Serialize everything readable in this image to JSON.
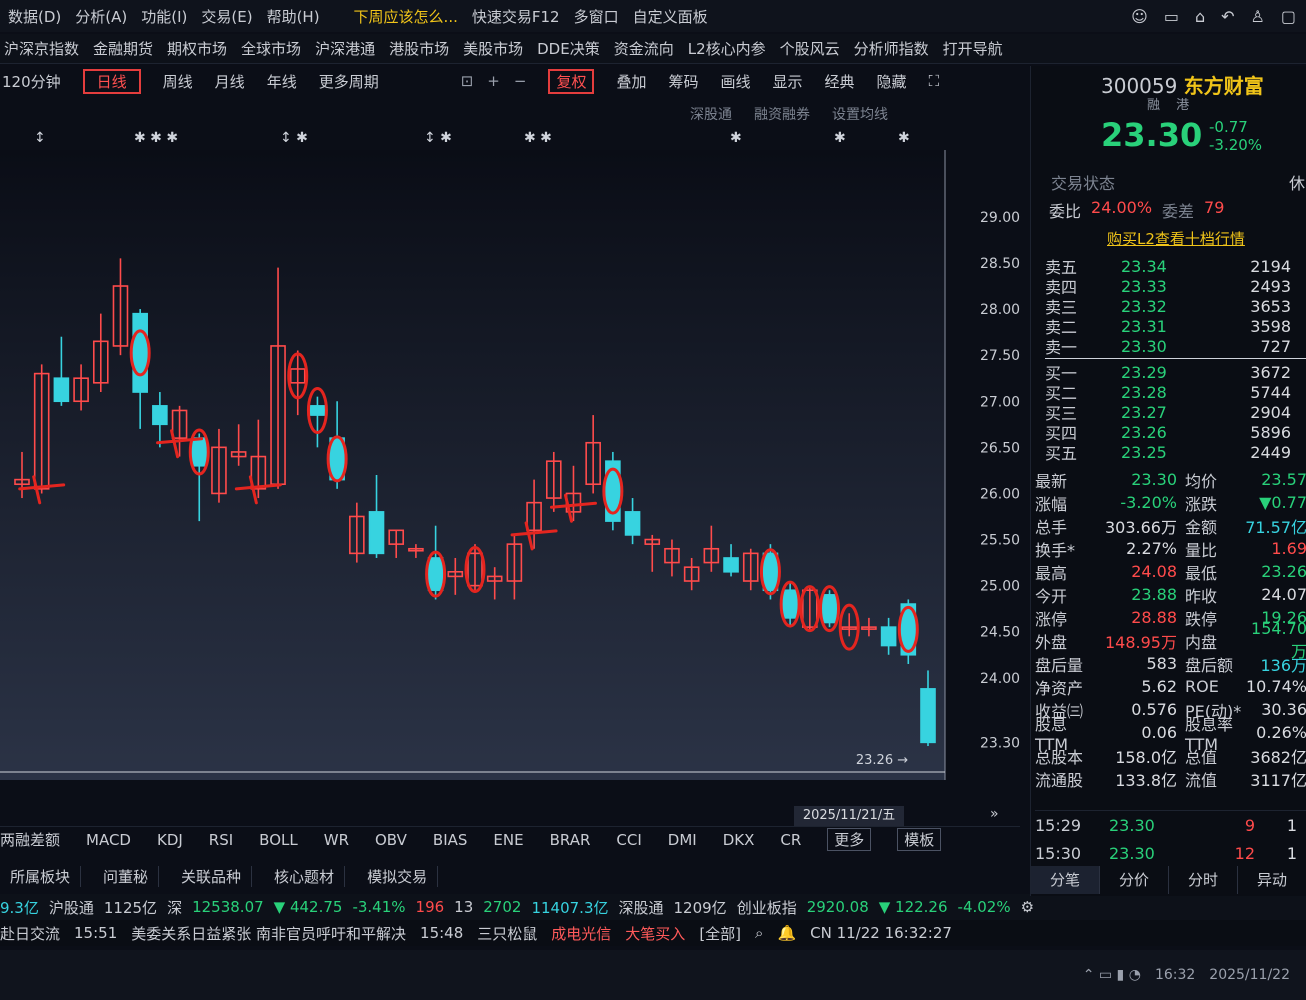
{
  "menubar": {
    "items": [
      "数据(D)",
      "分析(A)",
      "功能(I)",
      "交易(E)",
      "帮助(H)"
    ],
    "ad": "下周应该怎么...",
    "quick_trade": "快速交易F12",
    "multi_window": "多窗口",
    "custom_panel": "自定义面板"
  },
  "navbar": {
    "items": [
      "沪深京指数",
      "金融期货",
      "期权市场",
      "全球市场",
      "沪深港通",
      "港股市场",
      "美股市场",
      "DDE决策",
      "资金流向",
      "L2核心内参",
      "个股风云",
      "分析师指数",
      "打开导航"
    ]
  },
  "toolbar": {
    "period_prefix": "120分钟",
    "active_period": "日线",
    "periods": [
      "周线",
      "月线",
      "年线",
      "更多周期"
    ],
    "fuquan": "复权",
    "items": [
      "叠加",
      "筹码",
      "画线",
      "显示",
      "经典",
      "隐藏"
    ]
  },
  "subtool": [
    "深股通",
    "融资融券",
    "设置均线"
  ],
  "chart_data": {
    "type": "candlestick",
    "y_ticks": [
      "29.00",
      "28.50",
      "28.00",
      "27.50",
      "27.00",
      "26.50",
      "26.00",
      "25.50",
      "25.00",
      "24.50",
      "24.00",
      "23.30"
    ],
    "ylim": [
      23.0,
      29.4
    ],
    "last_label": "23.26",
    "date": "2025/11/21/五",
    "candles": [
      {
        "o": 26.1,
        "h": 26.45,
        "l": 25.95,
        "c": 26.15
      },
      {
        "o": 26.05,
        "h": 27.4,
        "l": 26.0,
        "c": 27.3
      },
      {
        "o": 27.25,
        "h": 27.7,
        "l": 26.95,
        "c": 27.0
      },
      {
        "o": 27.0,
        "h": 27.4,
        "l": 26.9,
        "c": 27.25
      },
      {
        "o": 27.2,
        "h": 27.95,
        "l": 27.1,
        "c": 27.65
      },
      {
        "o": 27.6,
        "h": 28.55,
        "l": 27.5,
        "c": 28.25
      },
      {
        "o": 27.95,
        "h": 28.0,
        "l": 26.7,
        "c": 27.1
      },
      {
        "o": 26.95,
        "h": 27.1,
        "l": 26.5,
        "c": 26.75
      },
      {
        "o": 26.6,
        "h": 26.95,
        "l": 26.4,
        "c": 26.9
      },
      {
        "o": 26.6,
        "h": 26.65,
        "l": 25.7,
        "c": 26.3
      },
      {
        "o": 26.0,
        "h": 26.7,
        "l": 25.9,
        "c": 26.5
      },
      {
        "o": 26.4,
        "h": 26.75,
        "l": 26.3,
        "c": 26.45
      },
      {
        "o": 26.05,
        "h": 26.8,
        "l": 25.95,
        "c": 26.4
      },
      {
        "o": 26.1,
        "h": 28.45,
        "l": 26.05,
        "c": 27.6
      },
      {
        "o": 27.2,
        "h": 27.55,
        "l": 26.85,
        "c": 27.35
      },
      {
        "o": 26.95,
        "h": 27.05,
        "l": 26.5,
        "c": 26.85
      },
      {
        "o": 26.6,
        "h": 27.0,
        "l": 26.05,
        "c": 26.15
      },
      {
        "o": 25.35,
        "h": 25.9,
        "l": 25.25,
        "c": 25.75
      },
      {
        "o": 25.8,
        "h": 26.2,
        "l": 25.3,
        "c": 25.35
      },
      {
        "o": 25.45,
        "h": 25.6,
        "l": 25.3,
        "c": 25.6
      },
      {
        "o": 25.4,
        "h": 25.45,
        "l": 25.3,
        "c": 25.4
      },
      {
        "o": 25.3,
        "h": 25.65,
        "l": 24.85,
        "c": 24.95
      },
      {
        "o": 25.1,
        "h": 25.3,
        "l": 24.9,
        "c": 25.15
      },
      {
        "o": 25.0,
        "h": 25.45,
        "l": 24.95,
        "c": 25.35
      },
      {
        "o": 25.05,
        "h": 25.2,
        "l": 24.85,
        "c": 25.1
      },
      {
        "o": 25.05,
        "h": 25.55,
        "l": 24.85,
        "c": 25.45
      },
      {
        "o": 25.6,
        "h": 26.15,
        "l": 25.4,
        "c": 25.9
      },
      {
        "o": 25.95,
        "h": 26.45,
        "l": 25.8,
        "c": 26.35
      },
      {
        "o": 25.8,
        "h": 26.3,
        "l": 25.7,
        "c": 26.0
      },
      {
        "o": 26.1,
        "h": 26.85,
        "l": 26.0,
        "c": 26.55
      },
      {
        "o": 26.35,
        "h": 26.45,
        "l": 25.6,
        "c": 25.7
      },
      {
        "o": 25.8,
        "h": 25.95,
        "l": 25.45,
        "c": 25.55
      },
      {
        "o": 25.45,
        "h": 25.55,
        "l": 25.15,
        "c": 25.5
      },
      {
        "o": 25.25,
        "h": 25.5,
        "l": 25.1,
        "c": 25.4
      },
      {
        "o": 25.05,
        "h": 25.3,
        "l": 24.95,
        "c": 25.2
      },
      {
        "o": 25.25,
        "h": 25.65,
        "l": 25.15,
        "c": 25.4
      },
      {
        "o": 25.3,
        "h": 25.45,
        "l": 25.1,
        "c": 25.15
      },
      {
        "o": 25.05,
        "h": 25.4,
        "l": 24.95,
        "c": 25.35
      },
      {
        "o": 25.35,
        "h": 25.45,
        "l": 24.85,
        "c": 24.95
      },
      {
        "o": 24.95,
        "h": 25.05,
        "l": 24.55,
        "c": 24.65
      },
      {
        "o": 24.55,
        "h": 25.0,
        "l": 24.5,
        "c": 24.95
      },
      {
        "o": 24.9,
        "h": 24.95,
        "l": 24.55,
        "c": 24.6
      },
      {
        "o": 24.55,
        "h": 24.7,
        "l": 24.45,
        "c": 24.55
      },
      {
        "o": 24.55,
        "h": 24.65,
        "l": 24.45,
        "c": 24.55
      },
      {
        "o": 24.55,
        "h": 24.65,
        "l": 24.25,
        "c": 24.35
      },
      {
        "o": 24.8,
        "h": 24.85,
        "l": 24.15,
        "c": 24.25
      },
      {
        "o": 23.88,
        "h": 24.08,
        "l": 23.26,
        "c": 23.3
      }
    ]
  },
  "indicator_tabs": [
    "两融差额",
    "MACD",
    "KDJ",
    "RSI",
    "BOLL",
    "WR",
    "OBV",
    "BIAS",
    "ENE",
    "BRAR",
    "CCI",
    "DMI",
    "DKX",
    "CR",
    "更多",
    "模板"
  ],
  "plate_tabs": [
    "所属板块",
    "问董秘",
    "关联品种",
    "核心题材",
    "模拟交易"
  ],
  "ticker": {
    "sh_amount": "9.3亿",
    "hgt_label": "沪股通",
    "hgt_amount": "1125亿",
    "sz_label": "深",
    "sz_index": "12538.07",
    "sz_change": "▼ 442.75",
    "sz_pct": "-3.41%",
    "up": "196",
    "flat": "13",
    "down": "2702",
    "sz_volume": "11407.3亿",
    "sgt_label": "深股通",
    "sgt_amount": "1209亿",
    "cyb_label": "创业板指",
    "cyb_index": "2920.08",
    "cyb_change": "▼ 122.26",
    "cyb_pct": "-4.02%"
  },
  "news": {
    "left": "赴日交流",
    "time1": "15:51",
    "headline1": "美委关系日益紧张  南非官员呼吁和平解决",
    "time2": "15:48",
    "headline2": "三只松鼠",
    "signal": "成电光信",
    "signal_tag": "大笔买入",
    "filter": "[全部]",
    "clock": "CN 11/22 16:32:27"
  },
  "taskbar": {
    "time": "16:32",
    "date": "2025/11/22"
  },
  "stock": {
    "code": "300059",
    "name": "东方财富",
    "tags": "融 港",
    "price": "23.30",
    "change": "-0.77",
    "change_pct": "-3.20%",
    "status_label": "交易状态",
    "rest": "休",
    "wb_label": "委比",
    "wb_value": "24.00%",
    "wc_label": "委差",
    "wc_value": "79",
    "l2_link": "购买L2查看十档行情"
  },
  "asks": [
    {
      "label": "卖五",
      "price": "23.34",
      "vol": "2194"
    },
    {
      "label": "卖四",
      "price": "23.33",
      "vol": "2493"
    },
    {
      "label": "卖三",
      "price": "23.32",
      "vol": "3653"
    },
    {
      "label": "卖二",
      "price": "23.31",
      "vol": "3598"
    },
    {
      "label": "卖一",
      "price": "23.30",
      "vol": "727"
    }
  ],
  "bids": [
    {
      "label": "买一",
      "price": "23.29",
      "vol": "3672"
    },
    {
      "label": "买二",
      "price": "23.28",
      "vol": "5744"
    },
    {
      "label": "买三",
      "price": "23.27",
      "vol": "2904"
    },
    {
      "label": "买四",
      "price": "23.26",
      "vol": "5896"
    },
    {
      "label": "买五",
      "price": "23.25",
      "vol": "2449"
    }
  ],
  "stats": [
    {
      "l1": "最新",
      "v1": "23.30",
      "c1": "green",
      "l2": "均价",
      "v2": "23.57",
      "c2": "green"
    },
    {
      "l1": "涨幅",
      "v1": "-3.20%",
      "c1": "green",
      "l2": "涨跌",
      "v2": "▼0.77",
      "c2": "green"
    },
    {
      "l1": "总手",
      "v1": "303.66万",
      "c1": "white",
      "l2": "金额",
      "v2": "71.57亿",
      "c2": "cyan"
    },
    {
      "l1": "换手*",
      "v1": "2.27%",
      "c1": "white",
      "l2": "量比",
      "v2": "1.69",
      "c2": "red"
    },
    {
      "l1": "最高",
      "v1": "24.08",
      "c1": "red",
      "l2": "最低",
      "v2": "23.26",
      "c2": "green"
    },
    {
      "l1": "今开",
      "v1": "23.88",
      "c1": "green",
      "l2": "昨收",
      "v2": "24.07",
      "c2": "white"
    },
    {
      "l1": "涨停",
      "v1": "28.88",
      "c1": "red",
      "l2": "跌停",
      "v2": "19.26",
      "c2": "green"
    },
    {
      "l1": "外盘",
      "v1": "148.95万",
      "c1": "red",
      "l2": "内盘",
      "v2": "154.70万",
      "c2": "green"
    },
    {
      "l1": "盘后量",
      "v1": "583",
      "c1": "white",
      "l2": "盘后额",
      "v2": "136万",
      "c2": "cyan"
    },
    {
      "l1": "净资产",
      "v1": "5.62",
      "c1": "white",
      "l2": "ROE",
      "v2": "10.74%",
      "c2": "white"
    },
    {
      "l1": "收益㈢",
      "v1": "0.576",
      "c1": "white",
      "l2": "PE(动)*",
      "v2": "30.36",
      "c2": "white"
    },
    {
      "l1": "股息TTM",
      "v1": "0.06",
      "c1": "white",
      "l2": "股息率TTM",
      "v2": "0.26%",
      "c2": "white"
    },
    {
      "l1": "总股本",
      "v1": "158.0亿",
      "c1": "white",
      "l2": "总值",
      "v2": "3682亿",
      "c2": "white"
    },
    {
      "l1": "流通股",
      "v1": "133.8亿",
      "c1": "white",
      "l2": "流值",
      "v2": "3117亿",
      "c2": "white"
    }
  ],
  "ticks": [
    {
      "time": "15:29",
      "price": "23.30",
      "vol": "9",
      "n": "1"
    },
    {
      "time": "15:30",
      "price": "23.30",
      "vol": "12",
      "n": "1"
    }
  ],
  "panel_tabs": [
    "分笔",
    "分价",
    "分时",
    "异动"
  ],
  "colors": {
    "up": "#ff4b4b",
    "down": "#29d17a",
    "candle_down": "#37d3e0",
    "annotation": "#e4251f",
    "accent": "#f0c419"
  }
}
